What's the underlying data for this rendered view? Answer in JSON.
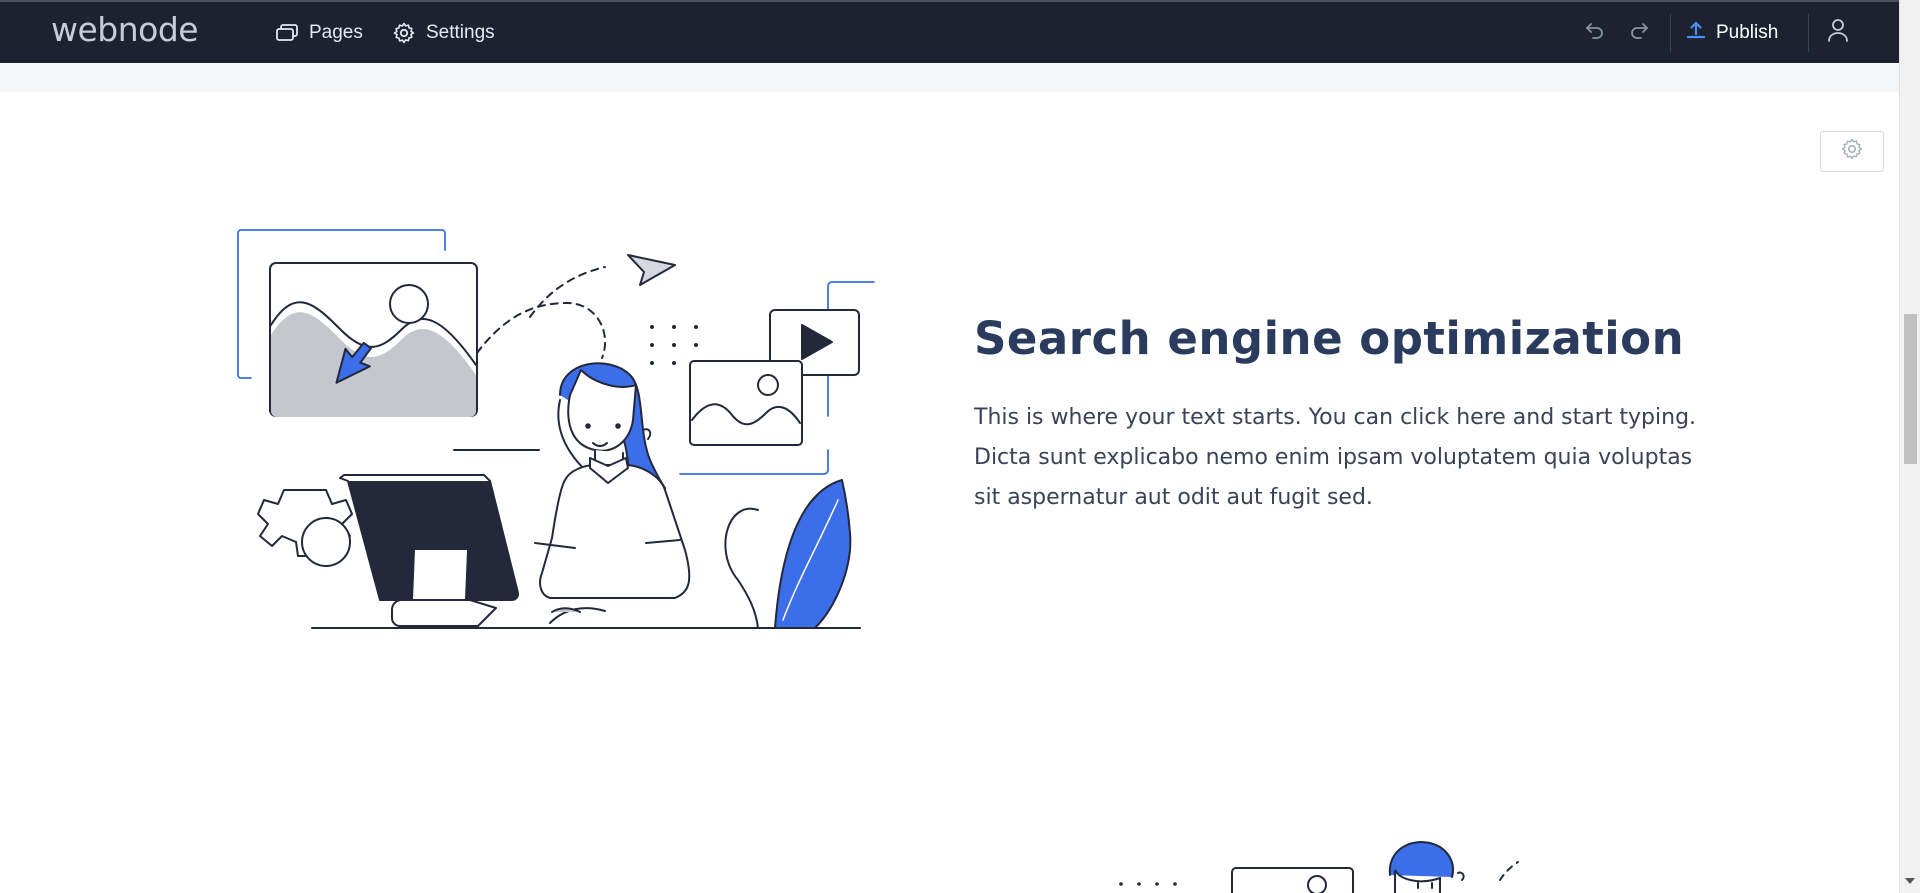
{
  "topbar": {
    "brand": "webnode",
    "nav": {
      "pages": "Pages",
      "settings": "Settings"
    },
    "publish_label": "Publish"
  },
  "section": {
    "heading": "Search engine optimization",
    "body": "This is where your text starts. You can click here and start typing. Dicta sunt explicabo nemo enim ipsam voluptatem quia voluptas sit aspernatur aut odit aut fugit sed."
  },
  "colors": {
    "topbar_bg": "#1c2230",
    "accent_blue": "#3b6ee8",
    "heading": "#2b3b5e"
  },
  "icons": [
    "pages-icon",
    "gear-icon",
    "undo-icon",
    "redo-icon",
    "upload-icon",
    "user-icon"
  ]
}
